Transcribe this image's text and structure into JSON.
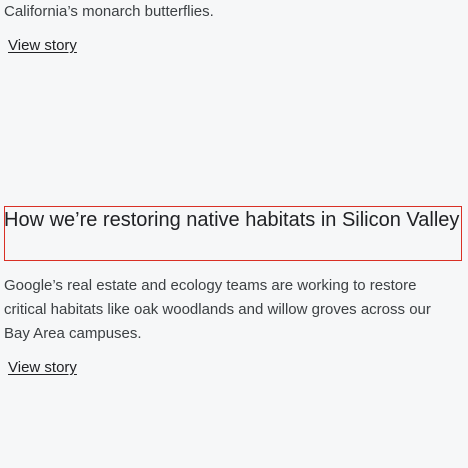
{
  "story_top": {
    "description_tail": "California’s monarch butterflies.",
    "link_label": "View story"
  },
  "story_main": {
    "title": "How we’re restoring native habitats in Silicon Valley",
    "description": "Google’s real estate and ecology teams are working to restore critical habitats like oak woodlands and willow groves across our Bay Area campuses.",
    "link_label": "View story"
  },
  "colors": {
    "page_background": "#f6f7f8",
    "highlight_border": "#d93025"
  }
}
